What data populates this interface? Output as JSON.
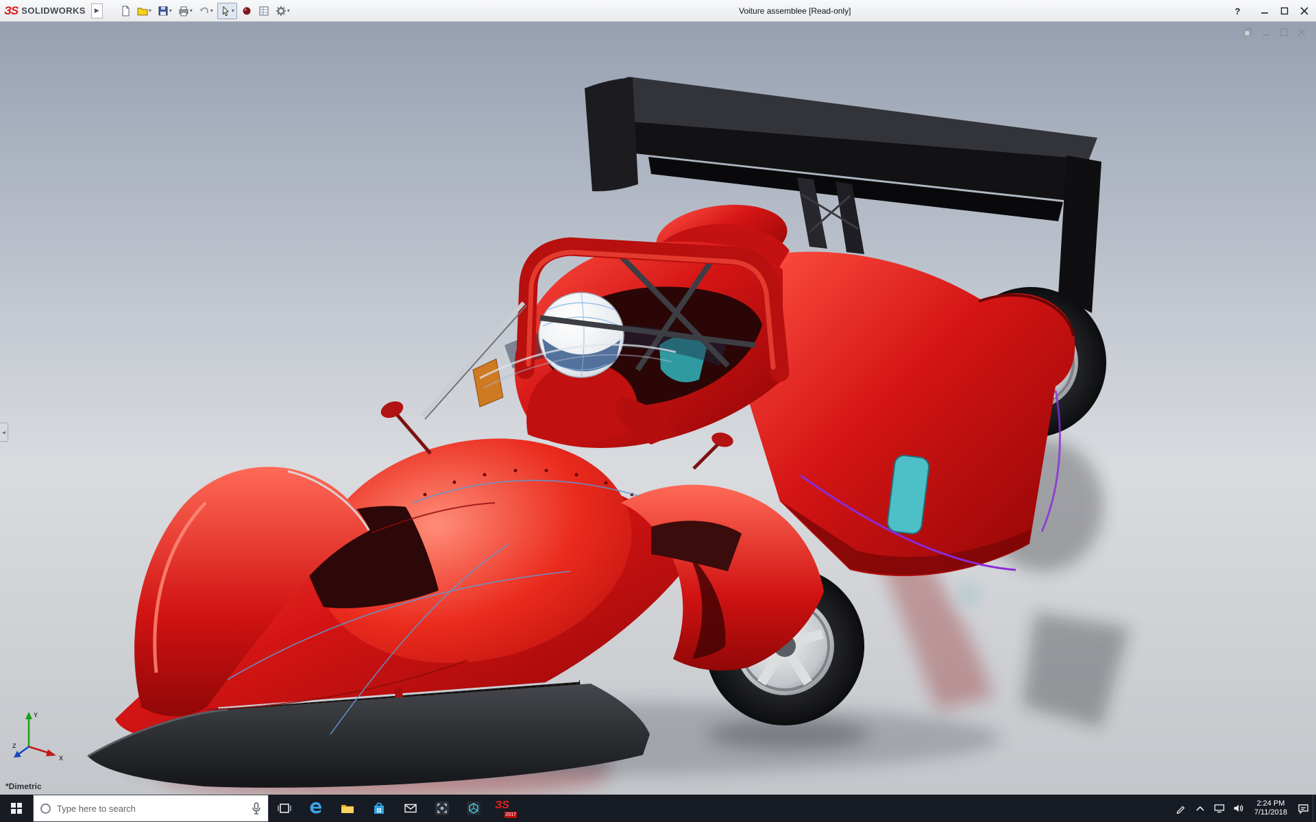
{
  "titlebar": {
    "brand_mark": "ЗS",
    "brand": "SOLIDWORKS",
    "title": "Voiture assemblee [Read-only]",
    "help": "?",
    "tools": [
      "new-document",
      "open",
      "save",
      "print",
      "undo",
      "select",
      "material-sphere",
      "design-table",
      "options"
    ],
    "window_controls": [
      "minimize",
      "maximize",
      "close"
    ]
  },
  "document_controls": [
    "restore",
    "minimize",
    "maximize",
    "close"
  ],
  "viewport": {
    "view_label": "*Dimetric",
    "triad": {
      "x": "X",
      "y": "Y",
      "z": "Z"
    },
    "model": "red race car assembly with black rear wing, driver and helmet"
  },
  "taskbar": {
    "search_placeholder": "Type here to search",
    "apps": [
      "start",
      "search",
      "task-view",
      "edge",
      "file-explorer",
      "store",
      "mail",
      "screenshot-app",
      "3d-viewer-app",
      "solidworks-2017"
    ],
    "solidworks_year": "2017",
    "tray": [
      "pen",
      "chevron-up",
      "network",
      "volume",
      "clock",
      "action-center",
      "show-desktop"
    ],
    "clock": {
      "time": "2:24 PM",
      "date": "7/11/2018"
    }
  },
  "colors": {
    "car_red": "#d31414",
    "wing_black": "#121215",
    "background_top": "#96a0b1",
    "taskbar_bg": "#171b24",
    "accent_teal": "#4cc0c6",
    "trim_purple": "#8a2bd8",
    "helmet_visor_blue": "#3d6090"
  }
}
